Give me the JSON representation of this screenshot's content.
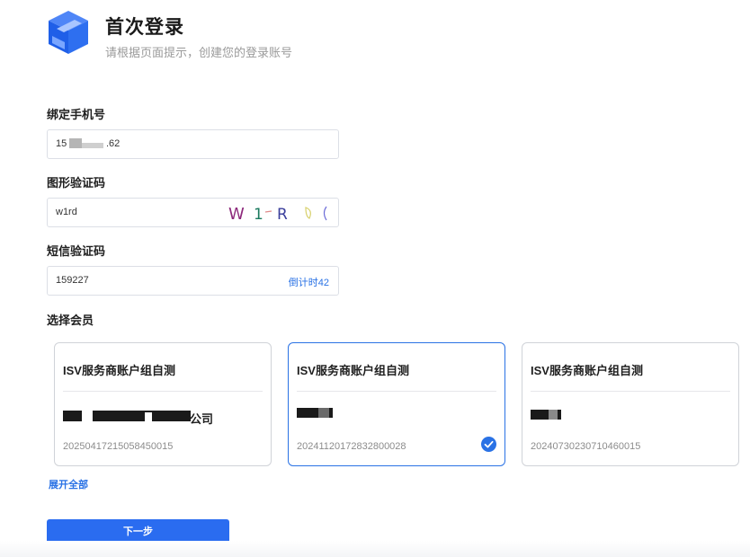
{
  "header": {
    "title": "首次登录",
    "subtitle": "请根据页面提示，创建您的登录账号",
    "logo_icon": "blue-cube-logo-icon"
  },
  "phone": {
    "label": "绑定手机号",
    "value_prefix": "15",
    "value_suffix": ".62"
  },
  "captcha": {
    "label": "图形验证码",
    "value": "w1rd",
    "image_text": "W 1 R"
  },
  "sms": {
    "label": "短信验证码",
    "value": "159227",
    "countdown": "倒计时42"
  },
  "member": {
    "label": "选择会员",
    "cards": [
      {
        "name": "ISV服务商账户组自测",
        "member_suffix": "公司",
        "member_id": "20250417215058450015",
        "selected": false
      },
      {
        "name": "ISV服务商账户组自测",
        "member_suffix": "",
        "member_id": "20241120172832800028",
        "selected": true
      },
      {
        "name": "ISV服务商账户组自测",
        "member_suffix": "",
        "member_id": "20240730230710460015",
        "selected": false
      }
    ],
    "expand_label": "展开全部"
  },
  "next_button": {
    "label": "下一步"
  },
  "colors": {
    "accent": "#2a72e5",
    "button": "#2a6cf0",
    "captcha_W": "#8e2a7c",
    "captcha_1": "#1a7a5e",
    "captcha_R": "#3b3f9c"
  }
}
